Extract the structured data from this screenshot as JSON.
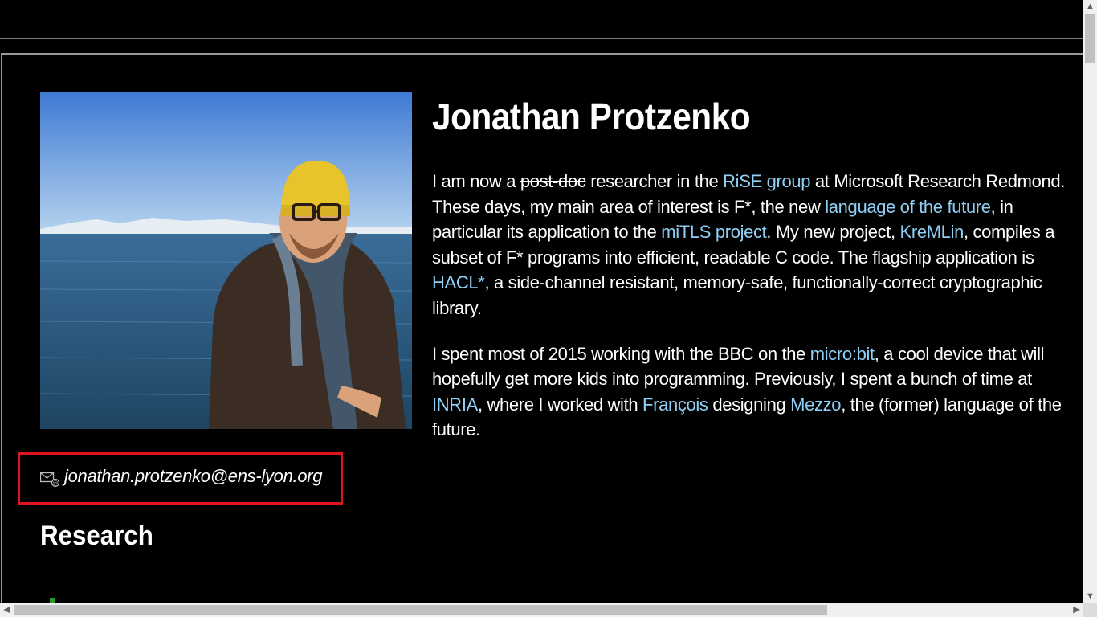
{
  "profile": {
    "name": "Jonathan Protzenko",
    "photo_alt": "Photo of Jonathan Protzenko"
  },
  "bio": {
    "p1": {
      "t1": "I am now a ",
      "strike": "post-doc",
      "t2": " researcher in the ",
      "link_rise": "RiSE group",
      "t3": " at Microsoft Research Redmond. These days, my main area of interest is F*, the new ",
      "link_lang": "language of the future",
      "t4": ", in particular its application to the ",
      "link_mitls": "miTLS project",
      "t5": ". My new project, ",
      "link_kremlin": "KreMLin",
      "t6": ", compiles a subset of F* programs into efficient, readable C code. The flagship application is ",
      "link_hacl": "HACL*",
      "t7": ", a side-channel resistant, memory-safe, functionally-correct cryptographic library."
    },
    "p2": {
      "t1": "I spent most of 2015 working with the BBC on the ",
      "link_microbit": "micro:bit",
      "t2": ", a cool device that will hopefully get more kids into programming. Previously, I spent a bunch of time at ",
      "link_inria": "INRIA",
      "t3": ", where I worked with ",
      "link_francois": "François",
      "t4": " designing ",
      "link_mezzo": "Mezzo",
      "t5": ", the (former) language of the future."
    }
  },
  "contact": {
    "email": "jonathan.protzenko@ens-lyon.org",
    "icon": "email-icon"
  },
  "sections": {
    "research": "Research"
  },
  "scrollbars": {
    "up": "▲",
    "down": "▼",
    "left": "◀",
    "right": "▶"
  },
  "colors": {
    "link": "#8fcff5",
    "highlight_border": "#e0141e",
    "background": "#000000"
  }
}
